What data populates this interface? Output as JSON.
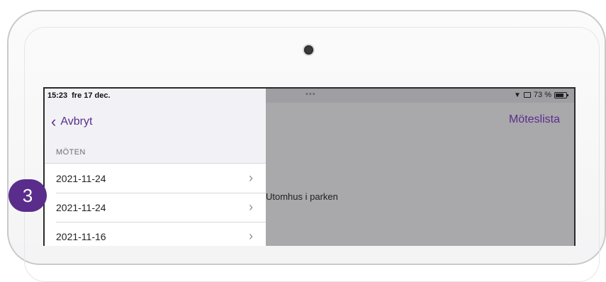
{
  "status_bar": {
    "time": "15:23",
    "date": "fre 17 dec.",
    "dots": "•••",
    "battery": "73 %"
  },
  "sidebar": {
    "back_label": "Avbryt",
    "section_header": "MÖTEN",
    "items": [
      {
        "label": "2021-11-24"
      },
      {
        "label": "2021-11-24"
      },
      {
        "label": "2021-11-16"
      }
    ]
  },
  "main": {
    "nav_title": "Möteslista",
    "content_text": "Utomhus i parken"
  },
  "step_badge": "3",
  "colors": {
    "accent": "#5a2d8c",
    "dimmed_background": "#a9a8aa"
  },
  "icons": [
    "camera",
    "chevron-left-icon",
    "chevron-right-icon",
    "wifi-icon",
    "cast-icon",
    "battery-icon"
  ]
}
